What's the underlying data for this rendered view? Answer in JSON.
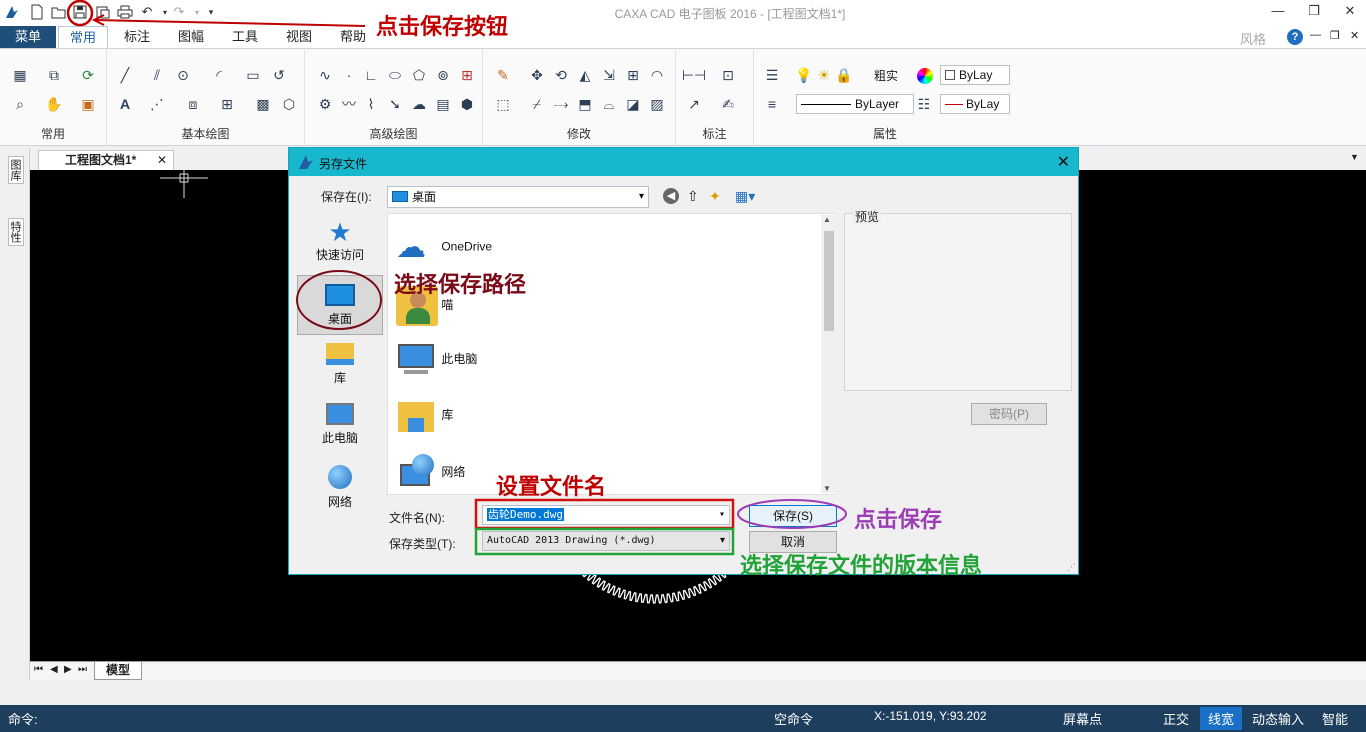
{
  "app": {
    "title": "CAXA CAD 电子图板 2016 - [工程图文档1*]",
    "style_label": "风格",
    "help_icon": "question-icon"
  },
  "menu": {
    "menu_button": "菜单",
    "tabs": [
      {
        "label": "常用",
        "active": true
      },
      {
        "label": "标注",
        "active": false
      },
      {
        "label": "图幅",
        "active": false
      },
      {
        "label": "工具",
        "active": false
      },
      {
        "label": "视图",
        "active": false
      },
      {
        "label": "帮助",
        "active": false
      }
    ]
  },
  "ribbon": {
    "groups": [
      "常用",
      "基本绘图",
      "高级绘图",
      "修改",
      "标注",
      "属性"
    ],
    "properties": {
      "linewidth_label": "粗实",
      "color_value": "ByLay",
      "linetype_value": "ByLayer",
      "linecolor_value": "ByLay"
    }
  },
  "document": {
    "tab_label": "工程图文档1*",
    "close_icon": "close-icon",
    "model_tab": "模型"
  },
  "side_panels": [
    "图库",
    "特性"
  ],
  "dialog": {
    "title": "另存文件",
    "save_in_label": "保存在(I):",
    "save_in_value": "桌面",
    "nav": [
      "快速访问",
      "桌面",
      "库",
      "此电脑",
      "网络"
    ],
    "files": [
      "OneDrive",
      "喵",
      "此电脑",
      "库",
      "网络"
    ],
    "preview_label": "预览",
    "password_button": "密码(P)",
    "filename_label": "文件名(N):",
    "filename_value": "齿轮Demo.dwg",
    "filetype_label": "保存类型(T):",
    "filetype_value": "AutoCAD 2013 Drawing (*.dwg)",
    "save_button": "保存(S)",
    "cancel_button": "取消"
  },
  "annotations": {
    "click_save_button": "点击保存按钮",
    "choose_path": "选择保存路径",
    "set_filename": "设置文件名",
    "click_save": "点击保存",
    "choose_version": "选择保存文件的版本信息"
  },
  "statusbar": {
    "command_label": "命令:",
    "empty_command": "空命令",
    "coords": "X:-151.019, Y:93.202",
    "screen_point": "屏幕点",
    "ortho": "正交",
    "linewidth": "线宽",
    "dynamic_input": "动态输入",
    "smart": "智能"
  },
  "colors": {
    "status_bg": "#1e3e5e",
    "dialog_title": "#17b8cd",
    "anno_red": "#c00000",
    "anno_green": "#22a339",
    "anno_purple": "#9b3db4",
    "anno_dark_red": "#7a0a18"
  }
}
